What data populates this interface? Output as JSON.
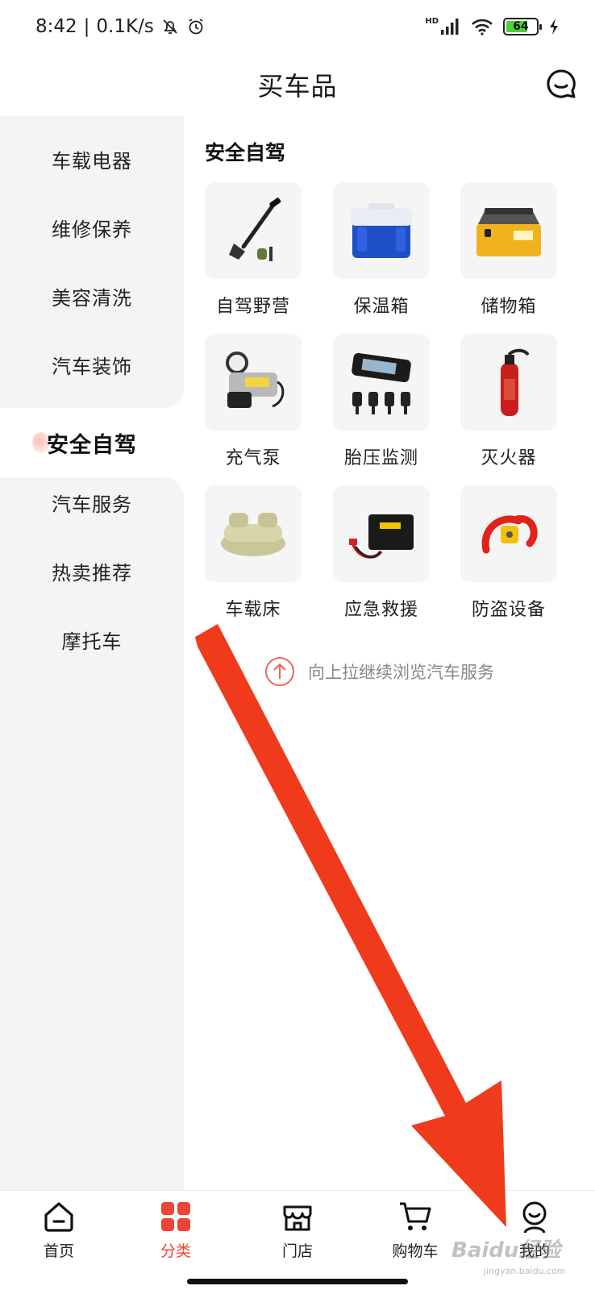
{
  "status_bar": {
    "time": "8:42",
    "speed": "0.1K/s",
    "network": "HD",
    "battery": "64"
  },
  "header": {
    "title": "买车品"
  },
  "sidebar": {
    "items": [
      {
        "label": "车载电器"
      },
      {
        "label": "维修保养"
      },
      {
        "label": "美容清洗"
      },
      {
        "label": "汽车装饰"
      },
      {
        "label": "安全自驾",
        "active": true
      },
      {
        "label": "汽车服务"
      },
      {
        "label": "热卖推荐"
      },
      {
        "label": "摩托车"
      }
    ]
  },
  "content": {
    "section_title": "安全自驾",
    "items": [
      {
        "label": "自驾野营",
        "icon": "camping-shovel"
      },
      {
        "label": "保温箱",
        "icon": "cooler-box"
      },
      {
        "label": "储物箱",
        "icon": "storage-box"
      },
      {
        "label": "充气泵",
        "icon": "air-pump"
      },
      {
        "label": "胎压监测",
        "icon": "tire-pressure-monitor"
      },
      {
        "label": "灭火器",
        "icon": "fire-extinguisher"
      },
      {
        "label": "车载床",
        "icon": "car-bed"
      },
      {
        "label": "应急救援",
        "icon": "emergency-kit"
      },
      {
        "label": "防盗设备",
        "icon": "anti-theft-lock"
      }
    ],
    "scroll_hint": "向上拉继续浏览汽车服务"
  },
  "tabbar": {
    "tabs": [
      {
        "label": "首页",
        "icon": "home-icon"
      },
      {
        "label": "分类",
        "icon": "category-icon",
        "active": true
      },
      {
        "label": "门店",
        "icon": "store-icon"
      },
      {
        "label": "购物车",
        "icon": "cart-icon"
      },
      {
        "label": "我的",
        "icon": "profile-icon"
      }
    ]
  },
  "watermark": {
    "text": "Baidu经验",
    "sub": "jingyan.baidu.com"
  },
  "colors": {
    "accent": "#ee4433",
    "sidebar_bg": "#f4f4f4",
    "annotation_arrow": "#f03a1c"
  }
}
